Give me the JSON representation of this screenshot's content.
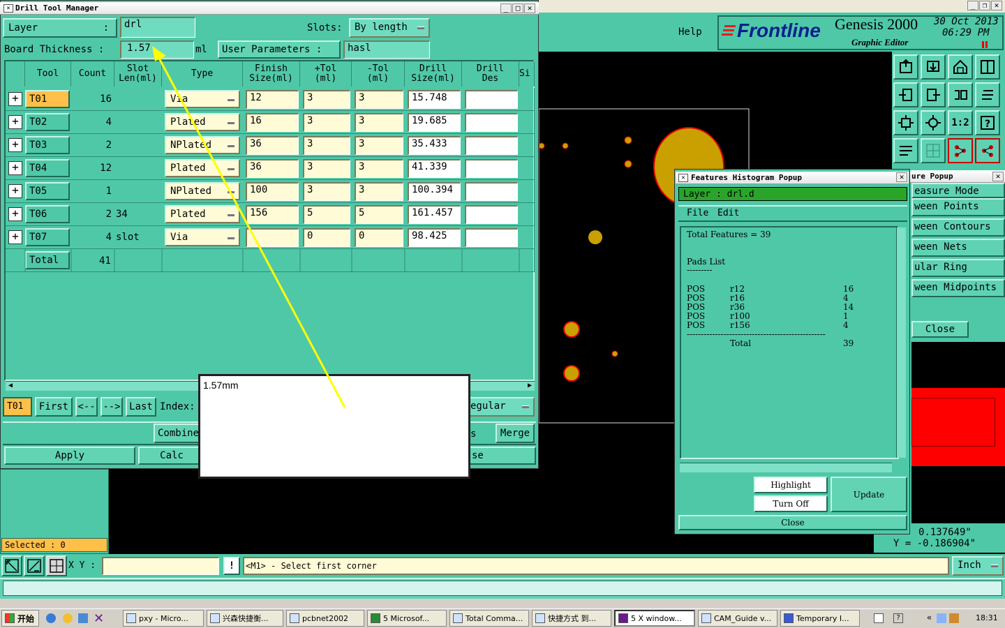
{
  "drill_window": {
    "title": "Drill Tool Manager",
    "layer_label": "Layer",
    "layer_colon": ":",
    "layer_value": "drl",
    "slots_label": "Slots:",
    "slots_value": "By length",
    "thickness_label": "Board Thickness :",
    "thickness_value": "1.57",
    "thickness_unit": "ml",
    "user_params_label": "User Parameters :",
    "user_params_value": "hasl",
    "headers": [
      "Tool",
      "Count",
      "Slot\nLen(ml)",
      "Type",
      "Finish\nSize(ml)",
      "+Tol\n(ml)",
      "-Tol\n(ml)",
      "Drill\nSize(ml)",
      "Drill\nDes",
      "Si"
    ],
    "rows": [
      {
        "tool": "T01",
        "count": "16",
        "slot": "",
        "type": "Via",
        "finish": "12",
        "ptol": "3",
        "mtol": "3",
        "drill": "15.748",
        "des": ""
      },
      {
        "tool": "T02",
        "count": "4",
        "slot": "",
        "type": "Plated",
        "finish": "16",
        "ptol": "3",
        "mtol": "3",
        "drill": "19.685",
        "des": ""
      },
      {
        "tool": "T03",
        "count": "2",
        "slot": "",
        "type": "NPlated",
        "finish": "36",
        "ptol": "3",
        "mtol": "3",
        "drill": "35.433",
        "des": ""
      },
      {
        "tool": "T04",
        "count": "12",
        "slot": "",
        "type": "Plated",
        "finish": "36",
        "ptol": "3",
        "mtol": "3",
        "drill": "41.339",
        "des": ""
      },
      {
        "tool": "T05",
        "count": "1",
        "slot": "",
        "type": "NPlated",
        "finish": "100",
        "ptol": "3",
        "mtol": "3",
        "drill": "100.394",
        "des": ""
      },
      {
        "tool": "T06",
        "count": "2",
        "slot": "34",
        "type": "Plated",
        "finish": "156",
        "ptol": "5",
        "mtol": "5",
        "drill": "161.457",
        "des": ""
      },
      {
        "tool": "T07",
        "count": "4",
        "slot": "slot",
        "type": "Via",
        "finish": "",
        "ptol": "0",
        "mtol": "0",
        "drill": "98.425",
        "des": ""
      }
    ],
    "total_label": "Total",
    "total_count": "41",
    "nav": {
      "current": "T01",
      "first": "First",
      "prev": "<--",
      "next": "-->",
      "last": "Last",
      "index": "Index:",
      "regular": "egular"
    },
    "combine": "Combine",
    "merge": "Merge",
    "apply": "Apply",
    "calc": "Calc",
    "close_partial": "se",
    "partial_s": "s",
    "selected": "Selected : 0"
  },
  "annotation_text": "1.57mm",
  "header": {
    "help": "Help",
    "brand": "Frontline",
    "product": "Genesis 2000",
    "subtitle": "Graphic Editor",
    "date": "30 Oct 2013",
    "time": "06:29 PM"
  },
  "histogram": {
    "title": "Features Histogram Popup",
    "layer": "Layer :  drl.d",
    "menu_file": "File",
    "menu_edit": "Edit",
    "total": "Total Features = 39",
    "pads_title": "Pads List",
    "pads_underline": "---------",
    "pads": [
      {
        "pol": "POS",
        "sym": "r12",
        "n": "16"
      },
      {
        "pol": "POS",
        "sym": "r16",
        "n": "4"
      },
      {
        "pol": "POS",
        "sym": "r36",
        "n": "14"
      },
      {
        "pol": "POS",
        "sym": "r100",
        "n": "1"
      },
      {
        "pol": "POS",
        "sym": "r156",
        "n": "4"
      }
    ],
    "separator": "-------------------------------------------------",
    "total_label": "Total",
    "total_value": "39",
    "highlight": "Highlight",
    "turn_off": "Turn Off",
    "update": "Update",
    "close": "Close"
  },
  "measure": {
    "title": "ure Popup",
    "items": [
      "easure Mode",
      "ween Points",
      "ween Contours",
      "ween Nets",
      "ular Ring",
      "ween Midpoints"
    ],
    "close": "Close",
    "x": "0.137649\"",
    "y": "Y = -0.186904\""
  },
  "statusbar": {
    "xy_label": "X Y :",
    "message": "<M1> - Select first corner",
    "units": "Inch"
  },
  "taskbar": {
    "start": "开始",
    "items": [
      "pxy - Micro...",
      "兴森快捷衡...",
      "pcbnet2002",
      "5 Microsof...",
      "Total Comma...",
      "快捷方式 到...",
      "5 X window...",
      "CAM_Guide v...",
      "Temporary I..."
    ],
    "clock": "18:31"
  },
  "colors": {
    "teal": "#4fc8a8",
    "field": "#fffbd6",
    "orange": "#ffc04a",
    "pad": "#c9a000",
    "pad_outline": "#e00000"
  }
}
